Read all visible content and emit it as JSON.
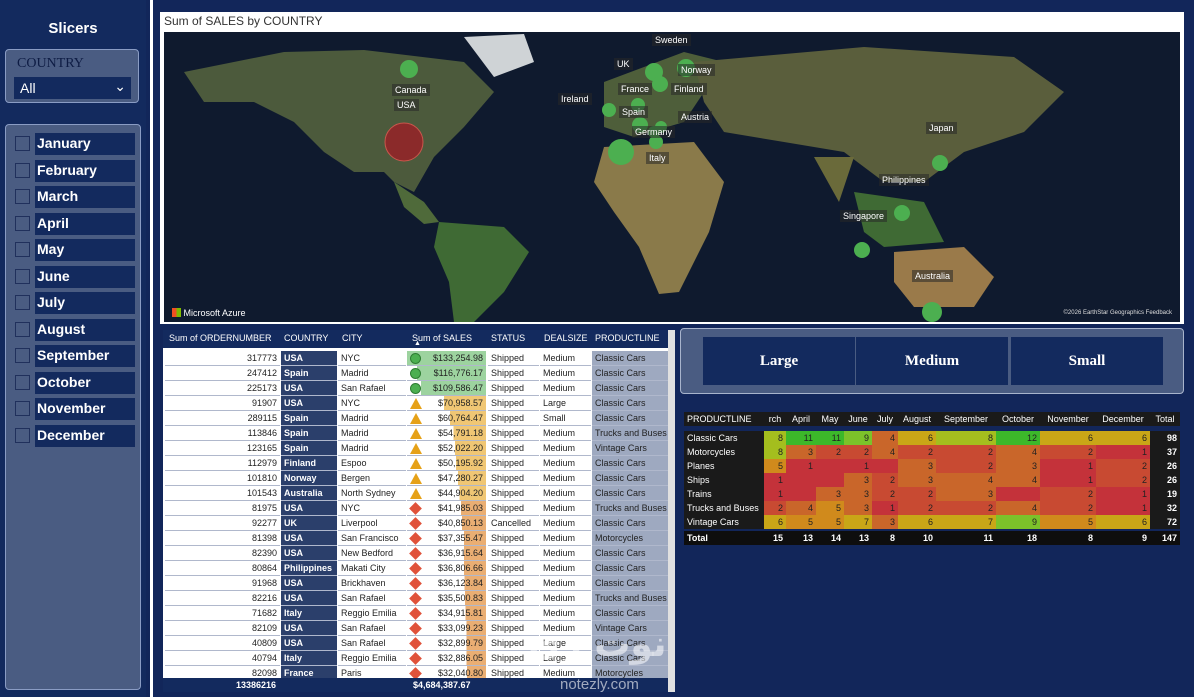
{
  "slicers": {
    "title": "Slicers",
    "country_label": "COUNTRY",
    "country_value": "All",
    "months": [
      "January",
      "February",
      "March",
      "April",
      "May",
      "June",
      "July",
      "August",
      "September",
      "October",
      "November",
      "December"
    ]
  },
  "map": {
    "title": "Sum of SALES by COUNTRY",
    "provider": "Microsoft Azure",
    "credit": "©2026 EarthStar Geographics  Feedback",
    "labels": [
      "Sweden",
      "UK",
      "Norway",
      "Canada",
      "France",
      "USA",
      "Ireland",
      "Finland",
      "Spain",
      "Austria",
      "Germany",
      "Japan",
      "Italy",
      "Philippines",
      "Singapore",
      "Australia"
    ]
  },
  "table": {
    "headers": [
      "Sum of ORDERNUMBER",
      "COUNTRY",
      "CITY",
      "Sum of SALES",
      "STATUS",
      "DEALSIZE",
      "PRODUCTLINE"
    ],
    "rows": [
      [
        "317773",
        "USA",
        "NYC",
        "$133,254.98",
        "Shipped",
        "Medium",
        "Classic Cars"
      ],
      [
        "247412",
        "Spain",
        "Madrid",
        "$116,776.17",
        "Shipped",
        "Medium",
        "Classic Cars"
      ],
      [
        "225173",
        "USA",
        "San Rafael",
        "$109,586.47",
        "Shipped",
        "Medium",
        "Classic Cars"
      ],
      [
        "91907",
        "USA",
        "NYC",
        "$70,958.57",
        "Shipped",
        "Large",
        "Classic Cars"
      ],
      [
        "289115",
        "Spain",
        "Madrid",
        "$60,764.47",
        "Shipped",
        "Small",
        "Classic Cars"
      ],
      [
        "113846",
        "Spain",
        "Madrid",
        "$54,791.18",
        "Shipped",
        "Medium",
        "Trucks and Buses"
      ],
      [
        "123165",
        "Spain",
        "Madrid",
        "$52,022.20",
        "Shipped",
        "Medium",
        "Vintage Cars"
      ],
      [
        "112979",
        "Finland",
        "Espoo",
        "$50,195.92",
        "Shipped",
        "Medium",
        "Classic Cars"
      ],
      [
        "101810",
        "Norway",
        "Bergen",
        "$47,280.27",
        "Shipped",
        "Medium",
        "Classic Cars"
      ],
      [
        "101543",
        "Australia",
        "North Sydney",
        "$44,904.20",
        "Shipped",
        "Medium",
        "Classic Cars"
      ],
      [
        "81975",
        "USA",
        "NYC",
        "$41,985.03",
        "Shipped",
        "Medium",
        "Trucks and Buses"
      ],
      [
        "92277",
        "UK",
        "Liverpool",
        "$40,850.13",
        "Cancelled",
        "Medium",
        "Classic Cars"
      ],
      [
        "81398",
        "USA",
        "San Francisco",
        "$37,355.47",
        "Shipped",
        "Medium",
        "Motorcycles"
      ],
      [
        "82390",
        "USA",
        "New Bedford",
        "$36,915.64",
        "Shipped",
        "Medium",
        "Classic Cars"
      ],
      [
        "80864",
        "Philippines",
        "Makati City",
        "$36,806.66",
        "Shipped",
        "Medium",
        "Classic Cars"
      ],
      [
        "91968",
        "USA",
        "Brickhaven",
        "$36,123.84",
        "Shipped",
        "Medium",
        "Classic Cars"
      ],
      [
        "82216",
        "USA",
        "San Rafael",
        "$35,500.83",
        "Shipped",
        "Medium",
        "Trucks and Buses"
      ],
      [
        "71682",
        "Italy",
        "Reggio Emilia",
        "$34,915.81",
        "Shipped",
        "Medium",
        "Classic Cars"
      ],
      [
        "82109",
        "USA",
        "San Rafael",
        "$33,099.23",
        "Shipped",
        "Medium",
        "Vintage Cars"
      ],
      [
        "40809",
        "USA",
        "San Rafael",
        "$32,899.79",
        "Shipped",
        "Large",
        "Classic Cars"
      ],
      [
        "40794",
        "Italy",
        "Reggio Emilia",
        "$32,886.05",
        "Shipped",
        "Large",
        "Classic Cars"
      ],
      [
        "82098",
        "France",
        "Paris",
        "$32,040.80",
        "Shipped",
        "Medium",
        "Motorcycles"
      ]
    ],
    "indicator_kinds": [
      "circle",
      "circle",
      "circle",
      "triangle",
      "triangle",
      "triangle",
      "triangle",
      "triangle",
      "triangle",
      "triangle",
      "diamond",
      "diamond",
      "diamond",
      "diamond",
      "diamond",
      "diamond",
      "diamond",
      "diamond",
      "diamond",
      "diamond",
      "diamond",
      "diamond"
    ],
    "indicator_colors": {
      "circle": "#4caf50",
      "triangle": "#e6a117",
      "diamond": "#e0523a"
    },
    "total_order": "13386216",
    "total_sales": "$4,684,387.67"
  },
  "dealsize": [
    "Large",
    "Medium",
    "Small"
  ],
  "matrix": {
    "headers": [
      "PRODUCTLINE",
      "rch",
      "April",
      "May",
      "June",
      "July",
      "August",
      "September",
      "October",
      "November",
      "December",
      "Total"
    ],
    "rows": [
      [
        "Classic Cars",
        "8",
        "11",
        "11",
        "9",
        "4",
        "6",
        "8",
        "12",
        "6",
        "6",
        "98"
      ],
      [
        "Motorcycles",
        "8",
        "3",
        "2",
        "2",
        "4",
        "2",
        "2",
        "4",
        "2",
        "1",
        "37"
      ],
      [
        "Planes",
        "5",
        "1",
        "",
        "1",
        "",
        "3",
        "2",
        "3",
        "1",
        "2",
        "26"
      ],
      [
        "Ships",
        "1",
        "",
        "",
        "3",
        "2",
        "3",
        "4",
        "4",
        "1",
        "2",
        "26"
      ],
      [
        "Trains",
        "1",
        "",
        "3",
        "3",
        "2",
        "2",
        "3",
        "",
        "2",
        "1",
        "19"
      ],
      [
        "Trucks and Buses",
        "2",
        "4",
        "5",
        "3",
        "1",
        "2",
        "2",
        "4",
        "2",
        "1",
        "32"
      ],
      [
        "Vintage Cars",
        "6",
        "5",
        "5",
        "7",
        "3",
        "6",
        "7",
        "9",
        "5",
        "6",
        "72"
      ]
    ],
    "total_row": [
      "Total",
      "15",
      "13",
      "14",
      "13",
      "8",
      "10",
      "11",
      "18",
      "8",
      "9",
      "147"
    ]
  },
  "watermark": {
    "text": "نوت زي",
    "url": "notezly.com"
  }
}
